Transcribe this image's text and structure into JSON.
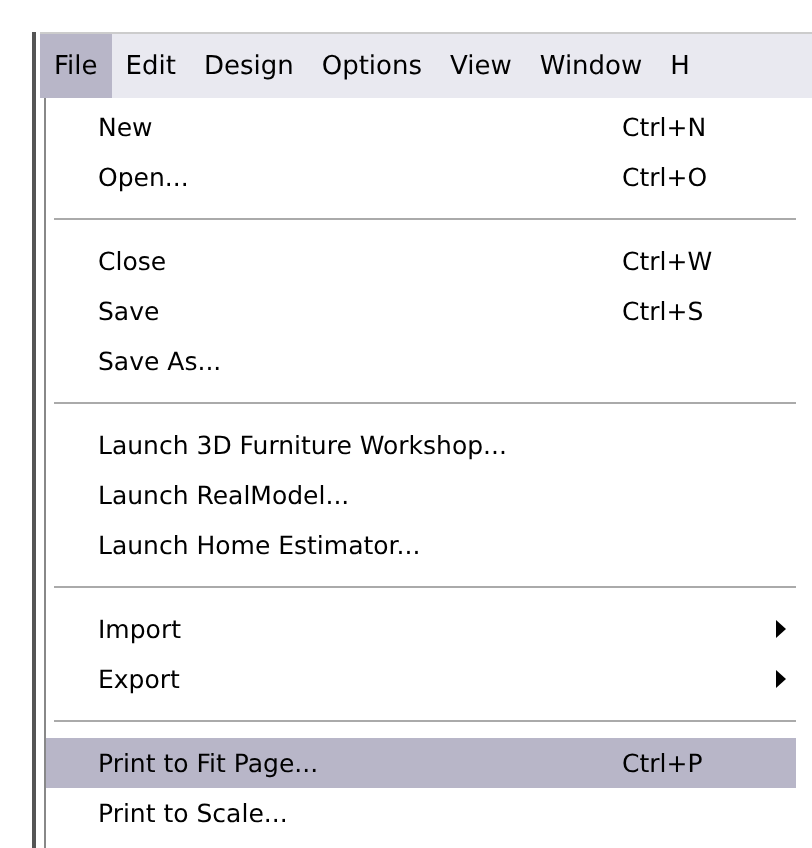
{
  "menu_bar": [
    {
      "label": "File",
      "selected": true
    },
    {
      "label": "Edit",
      "selected": false
    },
    {
      "label": "Design",
      "selected": false
    },
    {
      "label": "Options",
      "selected": false
    },
    {
      "label": "View",
      "selected": false
    },
    {
      "label": "Window",
      "selected": false
    },
    {
      "label": "H",
      "selected": false
    }
  ],
  "menu": {
    "groups": [
      [
        {
          "label": "New",
          "shortcut": "Ctrl+N",
          "submenu": false,
          "selected": false
        },
        {
          "label": "Open...",
          "shortcut": "Ctrl+O",
          "submenu": false,
          "selected": false
        }
      ],
      [
        {
          "label": "Close",
          "shortcut": "Ctrl+W",
          "submenu": false,
          "selected": false
        },
        {
          "label": "Save",
          "shortcut": "Ctrl+S",
          "submenu": false,
          "selected": false
        },
        {
          "label": "Save As...",
          "submenu": false,
          "selected": false
        }
      ],
      [
        {
          "label": "Launch 3D Furniture Workshop...",
          "submenu": false,
          "selected": false
        },
        {
          "label": "Launch RealModel...",
          "submenu": false,
          "selected": false
        },
        {
          "label": "Launch Home Estimator...",
          "submenu": false,
          "selected": false
        }
      ],
      [
        {
          "label": "Import",
          "submenu": true,
          "selected": false
        },
        {
          "label": "Export",
          "submenu": true,
          "selected": false
        }
      ],
      [
        {
          "label": "Print to Fit Page...",
          "shortcut": "Ctrl+P",
          "submenu": false,
          "selected": true
        },
        {
          "label": "Print to Scale...",
          "submenu": false,
          "selected": false
        }
      ]
    ]
  }
}
